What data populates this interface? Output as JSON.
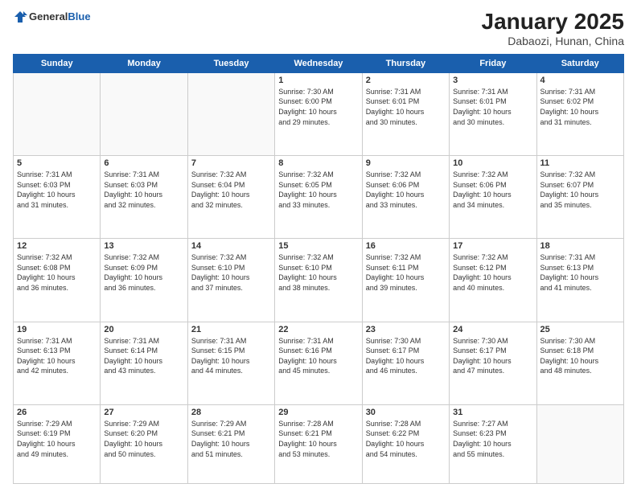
{
  "header": {
    "logo_general": "General",
    "logo_blue": "Blue",
    "title": "January 2025",
    "subtitle": "Dabaozi, Hunan, China"
  },
  "days_of_week": [
    "Sunday",
    "Monday",
    "Tuesday",
    "Wednesday",
    "Thursday",
    "Friday",
    "Saturday"
  ],
  "weeks": [
    [
      {
        "day": "",
        "info": ""
      },
      {
        "day": "",
        "info": ""
      },
      {
        "day": "",
        "info": ""
      },
      {
        "day": "1",
        "info": "Sunrise: 7:30 AM\nSunset: 6:00 PM\nDaylight: 10 hours\nand 29 minutes."
      },
      {
        "day": "2",
        "info": "Sunrise: 7:31 AM\nSunset: 6:01 PM\nDaylight: 10 hours\nand 30 minutes."
      },
      {
        "day": "3",
        "info": "Sunrise: 7:31 AM\nSunset: 6:01 PM\nDaylight: 10 hours\nand 30 minutes."
      },
      {
        "day": "4",
        "info": "Sunrise: 7:31 AM\nSunset: 6:02 PM\nDaylight: 10 hours\nand 31 minutes."
      }
    ],
    [
      {
        "day": "5",
        "info": "Sunrise: 7:31 AM\nSunset: 6:03 PM\nDaylight: 10 hours\nand 31 minutes."
      },
      {
        "day": "6",
        "info": "Sunrise: 7:31 AM\nSunset: 6:03 PM\nDaylight: 10 hours\nand 32 minutes."
      },
      {
        "day": "7",
        "info": "Sunrise: 7:32 AM\nSunset: 6:04 PM\nDaylight: 10 hours\nand 32 minutes."
      },
      {
        "day": "8",
        "info": "Sunrise: 7:32 AM\nSunset: 6:05 PM\nDaylight: 10 hours\nand 33 minutes."
      },
      {
        "day": "9",
        "info": "Sunrise: 7:32 AM\nSunset: 6:06 PM\nDaylight: 10 hours\nand 33 minutes."
      },
      {
        "day": "10",
        "info": "Sunrise: 7:32 AM\nSunset: 6:06 PM\nDaylight: 10 hours\nand 34 minutes."
      },
      {
        "day": "11",
        "info": "Sunrise: 7:32 AM\nSunset: 6:07 PM\nDaylight: 10 hours\nand 35 minutes."
      }
    ],
    [
      {
        "day": "12",
        "info": "Sunrise: 7:32 AM\nSunset: 6:08 PM\nDaylight: 10 hours\nand 36 minutes."
      },
      {
        "day": "13",
        "info": "Sunrise: 7:32 AM\nSunset: 6:09 PM\nDaylight: 10 hours\nand 36 minutes."
      },
      {
        "day": "14",
        "info": "Sunrise: 7:32 AM\nSunset: 6:10 PM\nDaylight: 10 hours\nand 37 minutes."
      },
      {
        "day": "15",
        "info": "Sunrise: 7:32 AM\nSunset: 6:10 PM\nDaylight: 10 hours\nand 38 minutes."
      },
      {
        "day": "16",
        "info": "Sunrise: 7:32 AM\nSunset: 6:11 PM\nDaylight: 10 hours\nand 39 minutes."
      },
      {
        "day": "17",
        "info": "Sunrise: 7:32 AM\nSunset: 6:12 PM\nDaylight: 10 hours\nand 40 minutes."
      },
      {
        "day": "18",
        "info": "Sunrise: 7:31 AM\nSunset: 6:13 PM\nDaylight: 10 hours\nand 41 minutes."
      }
    ],
    [
      {
        "day": "19",
        "info": "Sunrise: 7:31 AM\nSunset: 6:13 PM\nDaylight: 10 hours\nand 42 minutes."
      },
      {
        "day": "20",
        "info": "Sunrise: 7:31 AM\nSunset: 6:14 PM\nDaylight: 10 hours\nand 43 minutes."
      },
      {
        "day": "21",
        "info": "Sunrise: 7:31 AM\nSunset: 6:15 PM\nDaylight: 10 hours\nand 44 minutes."
      },
      {
        "day": "22",
        "info": "Sunrise: 7:31 AM\nSunset: 6:16 PM\nDaylight: 10 hours\nand 45 minutes."
      },
      {
        "day": "23",
        "info": "Sunrise: 7:30 AM\nSunset: 6:17 PM\nDaylight: 10 hours\nand 46 minutes."
      },
      {
        "day": "24",
        "info": "Sunrise: 7:30 AM\nSunset: 6:17 PM\nDaylight: 10 hours\nand 47 minutes."
      },
      {
        "day": "25",
        "info": "Sunrise: 7:30 AM\nSunset: 6:18 PM\nDaylight: 10 hours\nand 48 minutes."
      }
    ],
    [
      {
        "day": "26",
        "info": "Sunrise: 7:29 AM\nSunset: 6:19 PM\nDaylight: 10 hours\nand 49 minutes."
      },
      {
        "day": "27",
        "info": "Sunrise: 7:29 AM\nSunset: 6:20 PM\nDaylight: 10 hours\nand 50 minutes."
      },
      {
        "day": "28",
        "info": "Sunrise: 7:29 AM\nSunset: 6:21 PM\nDaylight: 10 hours\nand 51 minutes."
      },
      {
        "day": "29",
        "info": "Sunrise: 7:28 AM\nSunset: 6:21 PM\nDaylight: 10 hours\nand 53 minutes."
      },
      {
        "day": "30",
        "info": "Sunrise: 7:28 AM\nSunset: 6:22 PM\nDaylight: 10 hours\nand 54 minutes."
      },
      {
        "day": "31",
        "info": "Sunrise: 7:27 AM\nSunset: 6:23 PM\nDaylight: 10 hours\nand 55 minutes."
      },
      {
        "day": "",
        "info": ""
      }
    ]
  ]
}
